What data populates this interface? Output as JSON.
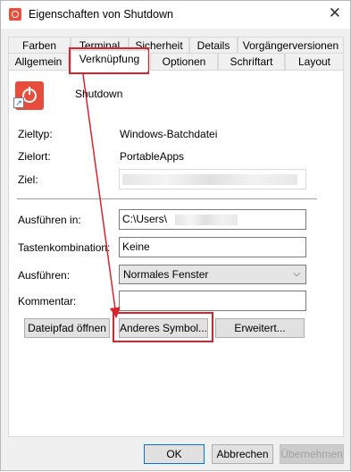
{
  "window": {
    "title": "Eigenschaften von Shutdown",
    "close_label": "✕"
  },
  "tabs_row1": [
    "Farben",
    "Terminal",
    "Sicherheit",
    "Details",
    "Vorgängerversionen"
  ],
  "tabs_row2": [
    "Allgemein",
    "Verknüpfung",
    "Optionen",
    "Schriftart",
    "Layout"
  ],
  "active_tab": "Verknüpfung",
  "shortcut": {
    "name": "Shutdown"
  },
  "info": {
    "zieltyp_label": "Zieltyp:",
    "zieltyp_value": "Windows-Batchdatei",
    "zielort_label": "Zielort:",
    "zielort_value": "PortableApps",
    "ziel_label": "Ziel:"
  },
  "form": {
    "ausfuehren_in_label": "Ausführen in:",
    "ausfuehren_in_value": "C:\\Users\\",
    "tastenkombination_label": "Tastenkombination:",
    "tastenkombination_value": "Keine",
    "ausfuehren_label": "Ausführen:",
    "ausfuehren_value": "Normales Fenster",
    "kommentar_label": "Kommentar:",
    "kommentar_value": ""
  },
  "buttons": {
    "dateipfad": "Dateipfad öffnen",
    "anderes_symbol": "Anderes Symbol...",
    "erweitert": "Erweitert...",
    "ok": "OK",
    "abbrechen": "Abbrechen",
    "uebernehmen": "Übernehmen"
  },
  "colors": {
    "highlight": "#d9232d",
    "app_icon": "#e74c3c"
  }
}
